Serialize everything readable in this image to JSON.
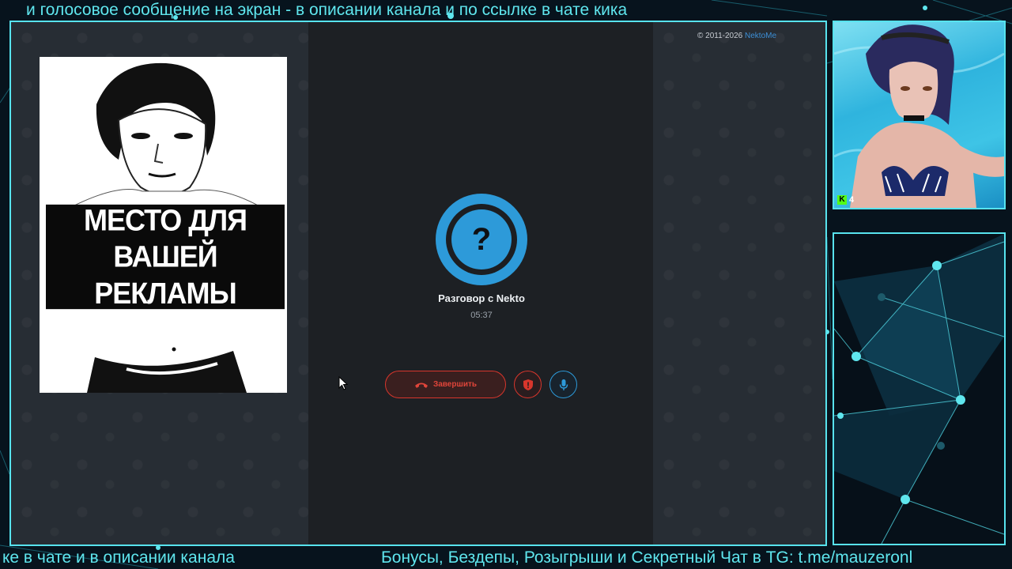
{
  "overlay": {
    "ticker_top": "и голосовое сообщение на экран - в описании канала и по ссылке в чате кика",
    "ticker_bottom_left": "ке в чате и в описании канала",
    "ticker_bottom_right": "Бонусы, Бездепы, Розыгрыши и Секретный Чат в TG: t.me/mauzeronl",
    "accent_color": "#57e3ee"
  },
  "site": {
    "copyright_prefix": "© 2011-2026",
    "brand": "NektoMe"
  },
  "ad": {
    "line1": "МЕСТО ДЛЯ",
    "line2": "ВАШЕЙ РЕКЛАМЫ"
  },
  "call": {
    "avatar_icon": "question-mark-icon",
    "avatar_glyph": "?",
    "title": "Разговор с Nekto",
    "timer": "05:37",
    "end_label": "Завершить",
    "end_icon": "phone-hangup-icon",
    "report_icon": "shield-icon",
    "mic_icon": "microphone-icon",
    "danger_color": "#d8362c",
    "primary_color": "#2d9ad9"
  },
  "webcam": {
    "platform_icon": "kick-logo-icon",
    "kick_glyph": "K",
    "viewer_count": "4"
  }
}
